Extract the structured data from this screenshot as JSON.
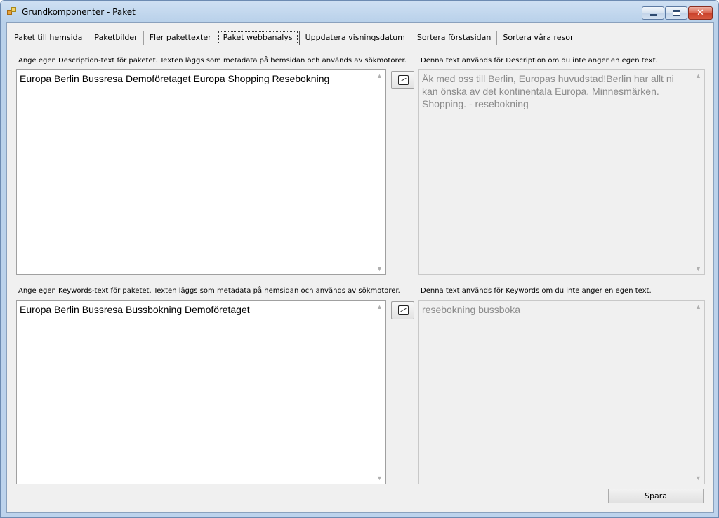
{
  "window": {
    "title": "Grundkomponenter - Paket",
    "close_glyph": "✕"
  },
  "tabs": [
    {
      "label": "Paket till hemsida"
    },
    {
      "label": "Paketbilder"
    },
    {
      "label": "Fler pakettexter"
    },
    {
      "label": "Paket webbanalys"
    },
    {
      "label": "Uppdatera visningsdatum"
    },
    {
      "label": "Sortera förstasidan"
    },
    {
      "label": "Sortera våra resor"
    }
  ],
  "active_tab": "Paket webbanalys",
  "description": {
    "own_label": "Ange egen Description-text för paketet. Texten läggs som metadata på hemsidan och används av sökmotorer.",
    "own_value": "Europa Berlin Bussresa Demoföretaget Europa Shopping Resebokning",
    "default_label": "Denna text används för Description om du inte anger en egen text.",
    "default_value": "Åk med oss till Berlin, Europas huvudstad!Berlin har allt ni kan önska av det kontinentala Europa. Minnesmärken. Shopping. - resebokning"
  },
  "keywords": {
    "own_label": "Ange egen Keywords-text för paketet. Texten  läggs som metadata på hemsidan och används av sökmotorer.",
    "own_value": "Europa Berlin Bussresa Bussbokning Demoföretaget",
    "default_label": "Denna text används för Keywords om du inte anger en egen text.",
    "default_value": "resebokning bussboka"
  },
  "buttons": {
    "save_label": "Spara"
  },
  "icons": {
    "app": "app-icon",
    "copy": "copy-arrow-icon",
    "scroll_up": "▲",
    "scroll_down": "▼"
  }
}
